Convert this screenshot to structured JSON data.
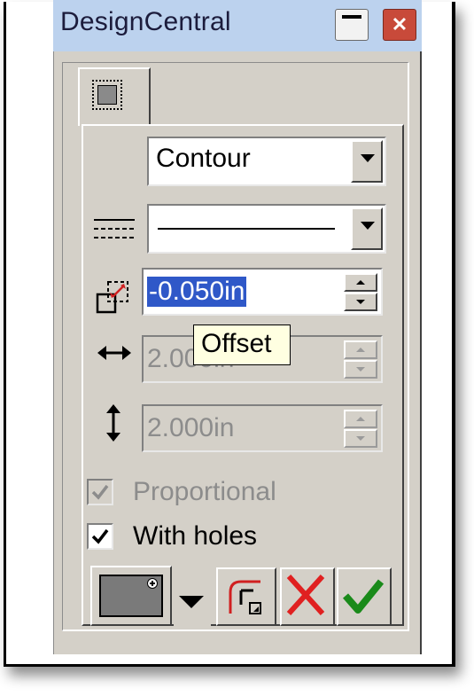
{
  "window": {
    "title": "DesignCentral"
  },
  "tabs": [
    {
      "icon": "selection-rect-icon"
    }
  ],
  "shape_select": {
    "value": "Contour"
  },
  "line_style_select": {
    "icon": "line-style-icon",
    "value_icon": "solid-line"
  },
  "offset_field": {
    "value": "-0.050in",
    "icon": "offset-icon",
    "tooltip": "Offset"
  },
  "width_field": {
    "value": "2.000in",
    "icon": "width-arrows-icon"
  },
  "height_field": {
    "value": "2.000in",
    "icon": "height-arrows-icon"
  },
  "checkboxes": {
    "proportional": {
      "label": "Proportional",
      "checked": true,
      "enabled": false
    },
    "with_holes": {
      "label": "With holes",
      "checked": true,
      "enabled": true
    }
  },
  "buttons": {
    "shape_preview": "rectangle-preview-icon",
    "dropdown": "chevron-down-icon",
    "corner": "corner-tool-icon",
    "cancel": "red-x-icon",
    "ok": "green-check-icon"
  },
  "colors": {
    "selection": "#2f58c8",
    "cancel": "#e02020",
    "ok": "#1a8a1a",
    "tooltip_bg": "#ffffe1"
  }
}
